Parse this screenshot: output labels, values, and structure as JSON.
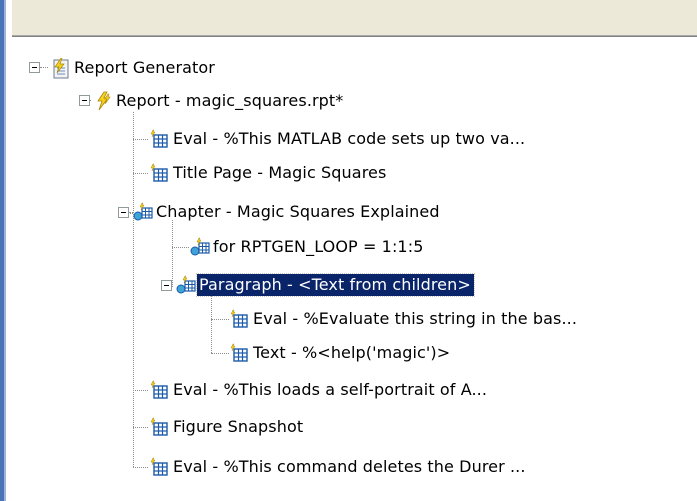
{
  "tree": {
    "nodes": [
      {
        "label": "Report Generator",
        "icon": "report-generator-icon",
        "expanded": true,
        "selected": false
      },
      {
        "label": "Report - magic_squares.rpt*",
        "icon": "report-bolt-icon",
        "expanded": true,
        "selected": false
      },
      {
        "label": "Eval - %This MATLAB code sets up two va...",
        "icon": "component-grid-icon",
        "selected": false
      },
      {
        "label": "Title Page - Magic Squares",
        "icon": "component-grid-icon",
        "selected": false
      },
      {
        "label": "Chapter - Magic Squares Explained",
        "icon": "component-group-icon",
        "expanded": true,
        "selected": false
      },
      {
        "label": "for RPTGEN_LOOP = 1:1:5",
        "icon": "component-group-icon",
        "selected": false
      },
      {
        "label": "Paragraph - <Text from children>",
        "icon": "component-group-icon",
        "expanded": true,
        "selected": true
      },
      {
        "label": "Eval - %Evaluate this string in the bas...",
        "icon": "component-grid-icon",
        "selected": false
      },
      {
        "label": "Text - %<help('magic')>",
        "icon": "component-grid-icon",
        "selected": false
      },
      {
        "label": "Eval - %This loads a self-portrait of A...",
        "icon": "component-grid-icon",
        "selected": false
      },
      {
        "label": "Figure Snapshot",
        "icon": "component-grid-icon",
        "selected": false
      },
      {
        "label": "Eval - %This command deletes the Durer ...",
        "icon": "component-grid-icon",
        "selected": false
      }
    ]
  },
  "colors": {
    "selection": "#0a246a",
    "selection_text": "#ffffff",
    "panel": "#ece9d8",
    "accent": "#4a74b8"
  }
}
